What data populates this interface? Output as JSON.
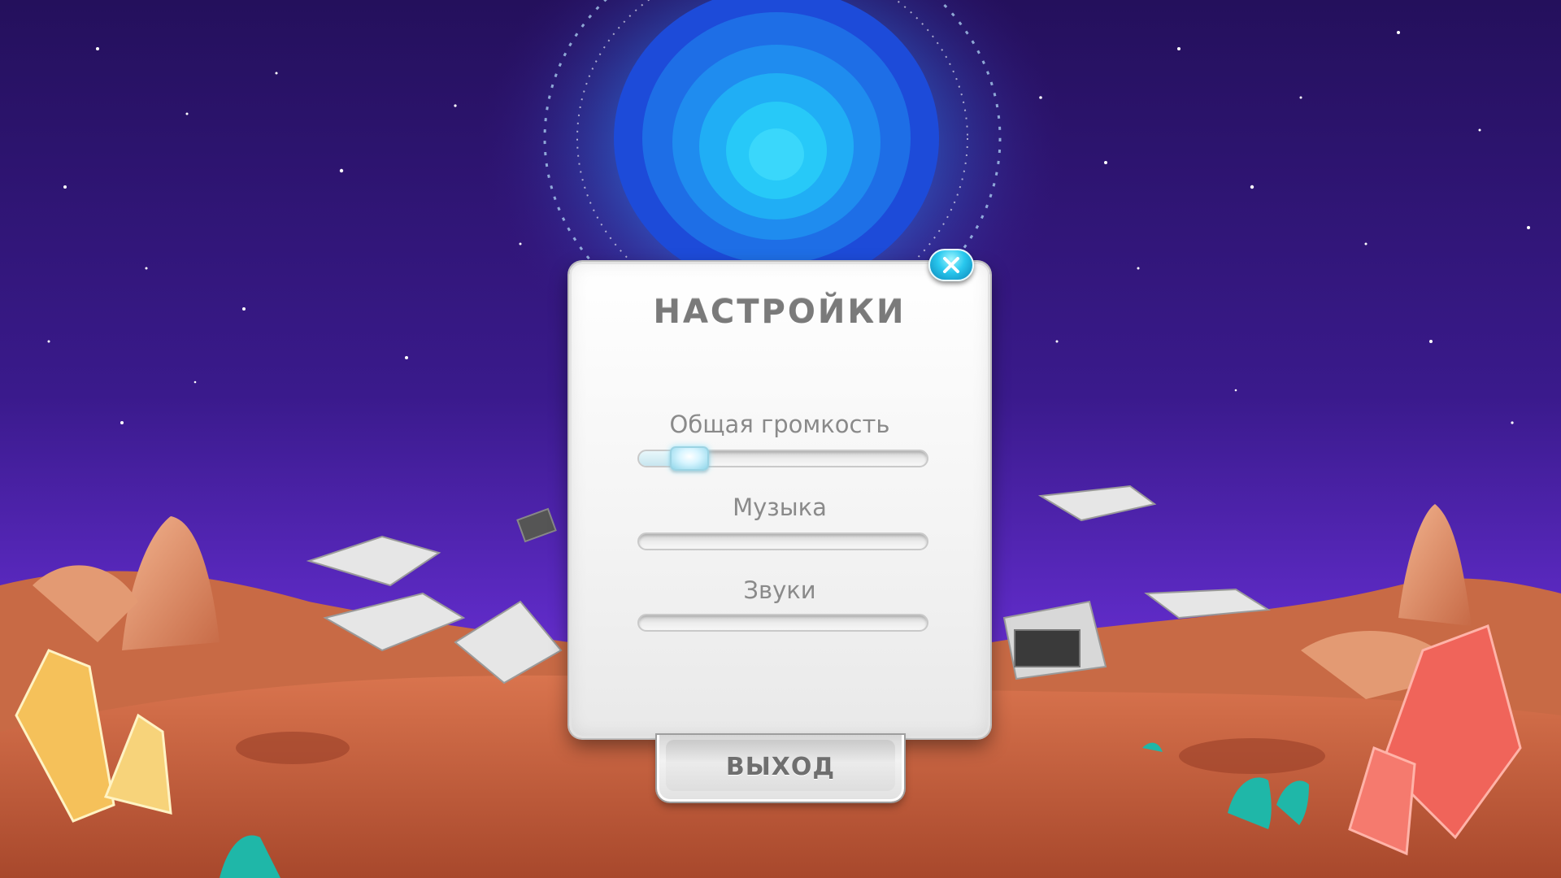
{
  "dialog": {
    "title": "НАСТРОЙКИ",
    "close_icon": "close-x-icon"
  },
  "sliders": [
    {
      "label": "Общая громкость",
      "value": 0.08
    },
    {
      "label": "Музыка",
      "value": 0.0
    },
    {
      "label": "Звуки",
      "value": 0.0
    }
  ],
  "exit_button": {
    "label": "ВЫХОД"
  },
  "colors": {
    "sky_top": "#26115f",
    "sky_bottom": "#6a2fd0",
    "portal": "#1fb6ff",
    "ground": "#c9603e",
    "accent_button": "#29c8ee"
  }
}
